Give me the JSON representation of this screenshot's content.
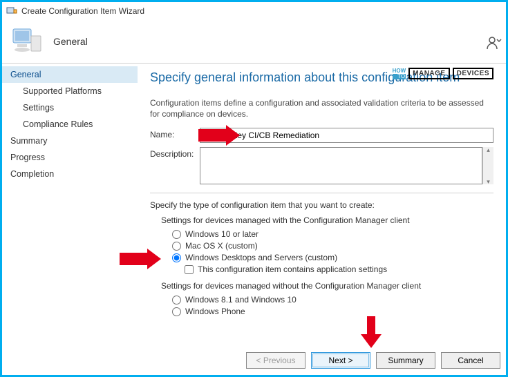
{
  "window": {
    "title": "Create Configuration Item Wizard"
  },
  "header": {
    "section": "General"
  },
  "sidebar": {
    "items": [
      {
        "label": "General",
        "active": true,
        "sub": false
      },
      {
        "label": "Supported Platforms",
        "active": false,
        "sub": true
      },
      {
        "label": "Settings",
        "active": false,
        "sub": true
      },
      {
        "label": "Compliance Rules",
        "active": false,
        "sub": true
      },
      {
        "label": "Summary",
        "active": false,
        "sub": false
      },
      {
        "label": "Progress",
        "active": false,
        "sub": false
      },
      {
        "label": "Completion",
        "active": false,
        "sub": false
      }
    ]
  },
  "main": {
    "title": "Specify general information about this configuration item",
    "intro": "Configuration items define a configuration and associated validation criteria to be assessed for compliance on devices.",
    "name_label": "Name:",
    "name_value": "HTMD_Key CI/CB Remediation",
    "desc_label": "Description:",
    "desc_value": "",
    "type_title": "Specify the type of configuration item that you want to create:",
    "group1_title": "Settings for devices managed with the Configuration Manager client",
    "opt_win10": "Windows 10 or later",
    "opt_mac": "Mac OS X (custom)",
    "opt_wds": "Windows Desktops and Servers (custom)",
    "opt_appsettings": "This configuration item contains application settings",
    "group2_title": "Settings for devices managed without the Configuration Manager client",
    "opt_win81": "Windows 8.1 and Windows 10",
    "opt_wp": "Windows Phone"
  },
  "buttons": {
    "previous": "< Previous",
    "next": "Next >",
    "summary": "Summary",
    "cancel": "Cancel"
  },
  "watermark": {
    "how": "HOW",
    "to": "TO",
    "manage": "MANAGE",
    "devices": "DEVICES"
  }
}
